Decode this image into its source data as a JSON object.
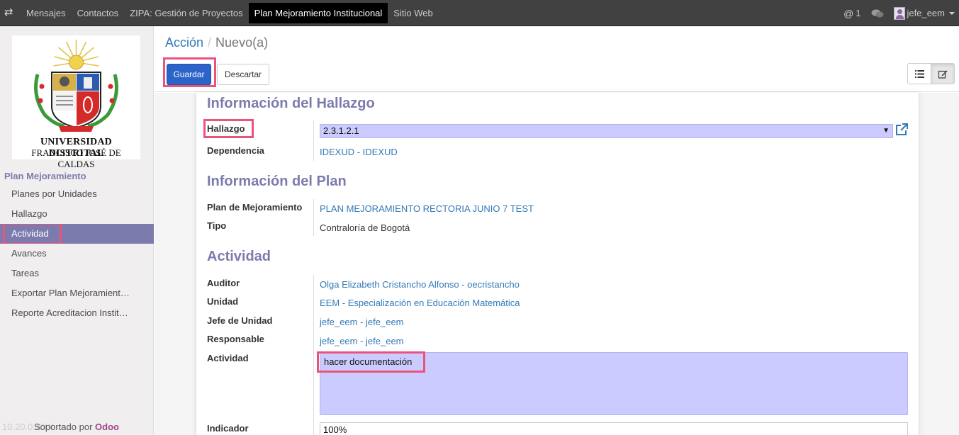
{
  "navbar": {
    "menu": [
      {
        "label": "Mensajes"
      },
      {
        "label": "Contactos"
      },
      {
        "label": "ZIPA: Gestión de Proyectos"
      },
      {
        "label": "Plan Mejoramiento Institucional"
      },
      {
        "label": "Sitio Web"
      }
    ],
    "mentions_count": "1",
    "user": "jefe_eem"
  },
  "sidebar": {
    "logo_line1": "UNIVERSIDAD DISTRITAL",
    "logo_line2": "FRANCISCO JOSÉ DE CALDAS",
    "section_title": "Plan Mejoramiento",
    "items": [
      {
        "label": "Planes por Unidades"
      },
      {
        "label": "Hallazgo"
      },
      {
        "label": "Actividad"
      },
      {
        "label": "Avances"
      },
      {
        "label": "Tareas"
      },
      {
        "label": "Exportar Plan Mejoramient…"
      },
      {
        "label": "Reporte Acreditacion Instit…"
      }
    ],
    "footer_ghost": "10.20.0.XXX",
    "footer_text": "Soportado por ",
    "footer_brand": "Odoo"
  },
  "control_panel": {
    "breadcrumb_link": "Acción",
    "breadcrumb_current": "Nuevo(a)",
    "save_label": "Guardar",
    "discard_label": "Descartar"
  },
  "form": {
    "section_hallazgo": "Información del Hallazgo",
    "hallazgo_label": "Hallazgo",
    "hallazgo_value": "2.3.1.2.1",
    "dependencia_label": "Dependencia",
    "dependencia_value": "IDEXUD - IDEXUD",
    "section_plan": "Información del Plan",
    "plan_label": "Plan de Mejoramiento",
    "plan_value": "PLAN MEJORAMIENTO RECTORIA JUNIO 7 TEST",
    "tipo_label": "Tipo",
    "tipo_value": "Contraloría de Bogotá",
    "section_actividad": "Actividad",
    "auditor_label": "Auditor",
    "auditor_value": "Olga Elizabeth Cristancho Alfonso - oecristancho",
    "unidad_label": "Unidad",
    "unidad_value": "EEM - Especialización en Educación Matemática",
    "jefe_label": "Jefe de Unidad",
    "jefe_value": "jefe_eem - jefe_eem",
    "responsable_label": "Responsable",
    "responsable_value": "jefe_eem - jefe_eem",
    "actividad_label": "Actividad",
    "actividad_value": "hacer documentación",
    "indicador_label": "Indicador",
    "indicador_value": "100%"
  },
  "colors": {
    "accent": "#7c7bad",
    "primary_button": "#2c63c9",
    "highlight": "#e8547c",
    "field_bg": "#cccbff"
  }
}
